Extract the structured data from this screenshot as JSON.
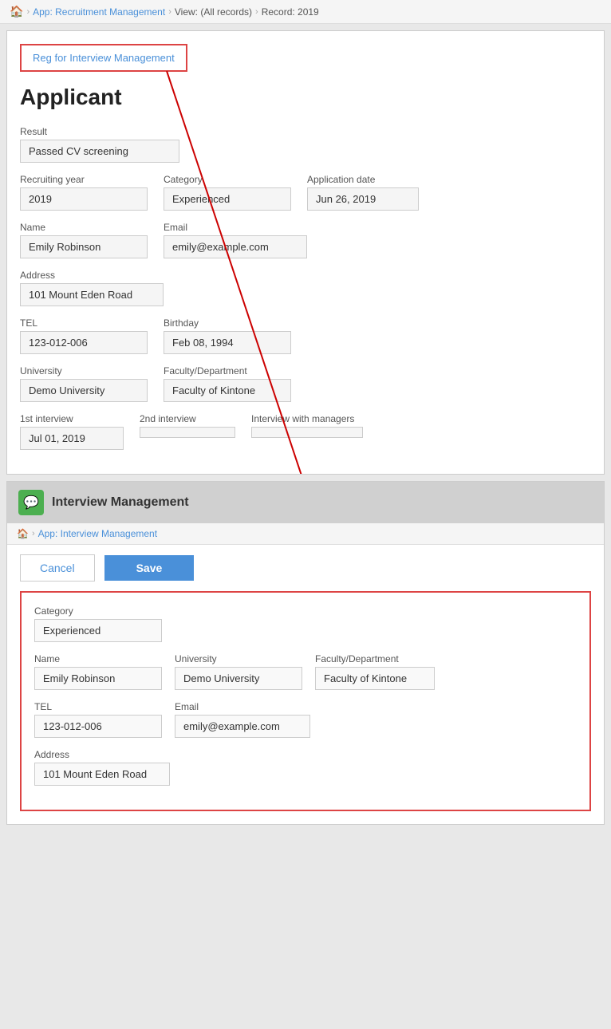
{
  "breadcrumb": {
    "home_icon": "🏠",
    "app_label": "App: Recruitment Management",
    "view_label": "View: (All records)",
    "record_label": "Record: 2019"
  },
  "reg_button": {
    "label": "Reg for Interview Management"
  },
  "applicant": {
    "section_title": "Applicant",
    "result_label": "Result",
    "result_value": "Passed CV screening",
    "recruiting_year_label": "Recruiting year",
    "recruiting_year_value": "2019",
    "category_label": "Category",
    "category_value": "Experienced",
    "application_date_label": "Application date",
    "application_date_value": "Jun 26, 2019",
    "name_label": "Name",
    "name_value": "Emily Robinson",
    "email_label": "Email",
    "email_value": "emily@example.com",
    "address_label": "Address",
    "address_value": "101 Mount Eden Road",
    "tel_label": "TEL",
    "tel_value": "123-012-006",
    "birthday_label": "Birthday",
    "birthday_value": "Feb 08, 1994",
    "university_label": "University",
    "university_value": "Demo University",
    "faculty_label": "Faculty/Department",
    "faculty_value": "Faculty of Kintone",
    "interview1_label": "1st interview",
    "interview1_value": "Jul 01, 2019",
    "interview2_label": "2nd interview",
    "interview2_value": "",
    "interview_managers_label": "Interview with managers",
    "interview_managers_value": ""
  },
  "interview_management": {
    "header_icon": "💬",
    "header_title": "Interview Management",
    "breadcrumb_home_icon": "🏠",
    "breadcrumb_app_label": "App: Interview Management",
    "cancel_label": "Cancel",
    "save_label": "Save",
    "form": {
      "category_label": "Category",
      "category_value": "Experienced",
      "name_label": "Name",
      "name_value": "Emily Robinson",
      "university_label": "University",
      "university_value": "Demo University",
      "faculty_label": "Faculty/Department",
      "faculty_value": "Faculty of Kintone",
      "tel_label": "TEL",
      "tel_value": "123-012-006",
      "email_label": "Email",
      "email_value": "emily@example.com",
      "address_label": "Address",
      "address_value": "101 Mount Eden Road"
    }
  }
}
